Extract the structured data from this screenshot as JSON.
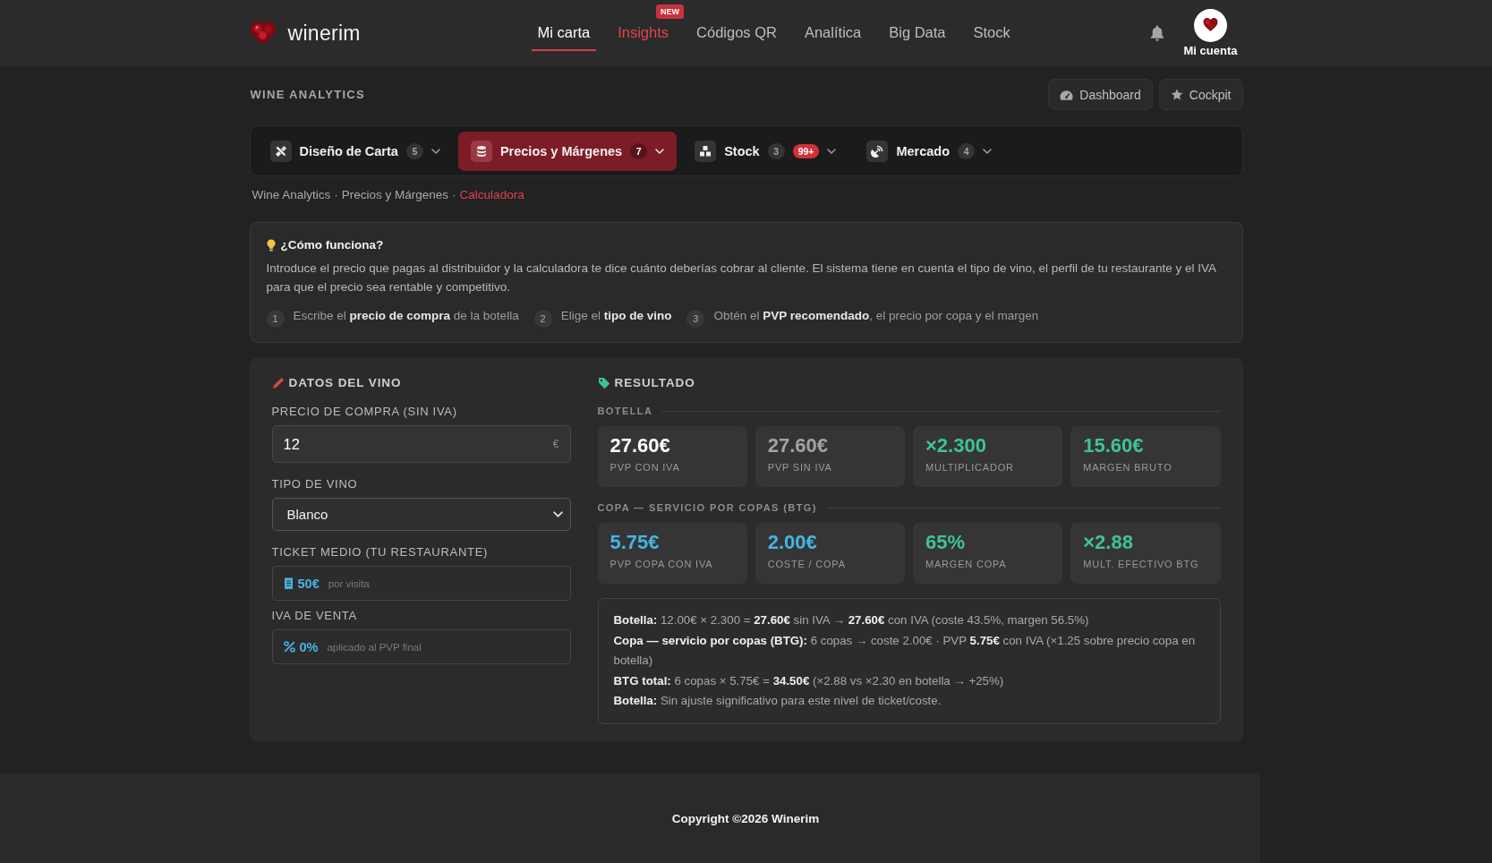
{
  "header": {
    "brand": "winerim",
    "nav": [
      {
        "label": "Mi carta",
        "selected": true,
        "highlighted": false
      },
      {
        "label": "Insights",
        "selected": false,
        "highlighted": true,
        "badge": "NEW"
      },
      {
        "label": "Códigos QR",
        "selected": false,
        "highlighted": false
      },
      {
        "label": "Analítica",
        "selected": false,
        "highlighted": false
      },
      {
        "label": "Big Data",
        "selected": false,
        "highlighted": false
      },
      {
        "label": "Stock",
        "selected": false,
        "highlighted": false
      }
    ],
    "account": {
      "label": "Mi cuenta"
    }
  },
  "page": {
    "title": "WINE ANALYTICS",
    "actions": [
      {
        "label": "Dashboard"
      },
      {
        "label": "Cockpit"
      }
    ]
  },
  "category_tabs": [
    {
      "label": "Diseño de Carta",
      "count": "5",
      "selected": false
    },
    {
      "label": "Precios y Márgenes",
      "count": "7",
      "selected": true
    },
    {
      "label": "Stock",
      "count": "3",
      "alert": "99+",
      "selected": false
    },
    {
      "label": "Mercado",
      "count": "4",
      "selected": false
    }
  ],
  "breadcrumb": {
    "separator": "·",
    "items": [
      {
        "label": "Wine Analytics",
        "current": false
      },
      {
        "label": "Precios y Márgenes",
        "current": false
      },
      {
        "label": "Calculadora",
        "current": true
      }
    ]
  },
  "how_it_works": {
    "title": "¿Cómo funciona?",
    "text": "Introduce el precio que pagas al distribuidor y la calculadora te dice cuánto deberías cobrar al cliente. El sistema tiene en cuenta el tipo de vino, el perfil de tu restaurante y el IVA para que el precio sea rentable y competitivo.",
    "steps": [
      {
        "number": "1",
        "text": "Escribe el **precio de compra** de la botella"
      },
      {
        "number": "2",
        "text": "Elige el **tipo de vino**"
      },
      {
        "number": "3",
        "text": "Obtén el **PVP recomendado**, el precio por copa y el margen"
      }
    ]
  },
  "form": {
    "title": "DATOS DEL VINO",
    "fields": [
      {
        "kind": "input",
        "label": "PRECIO DE COMPRA (SIN IVA)",
        "value": "12",
        "suffix": "€"
      },
      {
        "kind": "select",
        "label": "TIPO DE VINO",
        "value": "Blanco"
      },
      {
        "kind": "readout",
        "label": "TICKET MEDIO (TU RESTAURANTE)",
        "value": "50€",
        "note": "por visita"
      },
      {
        "kind": "readout",
        "label": "IVA DE VENTA",
        "value": "0%",
        "note": "aplicado al PVP final"
      }
    ]
  },
  "result": {
    "title": "RESULTADO",
    "groups": [
      {
        "title": "BOTELLA",
        "cards": [
          {
            "value": "27.60€",
            "label": "PVP CON IVA",
            "color": "#ffffff"
          },
          {
            "value": "27.60€",
            "label": "PVP SIN IVA",
            "color": "#a3a3a3"
          },
          {
            "value": "×2.300",
            "label": "MULTIPLICADOR",
            "color": "#3ec493"
          },
          {
            "value": "15.60€",
            "label": "MARGEN BRUTO",
            "color": "#3ec493"
          }
        ]
      },
      {
        "title": "COPA — SERVICIO POR COPAS (BTG)",
        "cards": [
          {
            "value": "5.75€",
            "label": "PVP COPA CON IVA",
            "color": "#45b5e3"
          },
          {
            "value": "2.00€",
            "label": "COSTE / COPA",
            "color": "#45b5e3"
          },
          {
            "value": "65%",
            "label": "MARGEN COPA",
            "color": "#3ec493"
          },
          {
            "value": "×2.88",
            "label": "MULT. EFECTIVO BTG",
            "color": "#3ec493"
          }
        ]
      }
    ],
    "summary": [
      "**Botella:** 12.00€ × 2.300 = **27.60€** sin IVA → **27.60€** con IVA (coste 43.5%, margen 56.5%)",
      "**Copa — servicio por copas (BTG):** 6 copas → coste 2.00€ · PVP **5.75€** con IVA (×1.25 sobre precio copa en botella)",
      "**BTG total:** 6 copas × 5.75€ = **34.50€** (×2.88 vs ×2.30 en botella → +25%)",
      "**Botella:** Sin ajuste significativo para este nivel de ticket/coste."
    ]
  },
  "footer": {
    "copyright": "Copyright ©2026 Winerim"
  }
}
